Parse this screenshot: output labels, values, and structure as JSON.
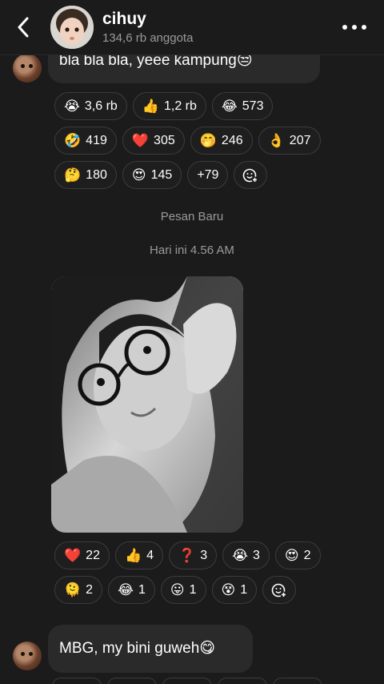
{
  "header": {
    "group_name": "cihuy",
    "members": "134,6 rb anggota"
  },
  "messages": {
    "first": {
      "text": "bla bla bla, yeee kampung😒",
      "reactions": [
        [
          {
            "emoji": "😭",
            "count": "3,6 rb"
          },
          {
            "emoji": "👍",
            "count": "1,2 rb"
          },
          {
            "emoji": "😂",
            "count": "573"
          }
        ],
        [
          {
            "emoji": "🤣",
            "count": "419"
          },
          {
            "emoji": "❤️",
            "count": "305"
          },
          {
            "emoji": "🤭",
            "count": "246"
          },
          {
            "emoji": "👌",
            "count": "207"
          }
        ],
        [
          {
            "emoji": "🤔",
            "count": "180"
          },
          {
            "emoji": "😍",
            "count": "145"
          },
          {
            "emoji": "",
            "count": "+79"
          }
        ]
      ]
    },
    "divider_new": "Pesan Baru",
    "timestamp": "Hari ini 4.56 AM",
    "photo": {
      "description_icon": "photo-image",
      "reactions": [
        [
          {
            "emoji": "❤️",
            "count": "22"
          },
          {
            "emoji": "👍",
            "count": "4"
          },
          {
            "emoji": "❓",
            "count": "3"
          },
          {
            "emoji": "😭",
            "count": "3"
          },
          {
            "emoji": "😍",
            "count": "2"
          }
        ],
        [
          {
            "emoji": "🫠",
            "count": "2"
          },
          {
            "emoji": "😂",
            "count": "1"
          },
          {
            "emoji": "😛",
            "count": "1"
          },
          {
            "emoji": "😵",
            "count": "1"
          }
        ]
      ]
    },
    "last": {
      "text": "MBG, my bini guweh😋"
    }
  },
  "colors": {
    "background": "#1b1b1b",
    "bubble": "#2a2a2a",
    "chip_border": "#3c3c3c",
    "secondary_text": "#9a9a9a"
  }
}
